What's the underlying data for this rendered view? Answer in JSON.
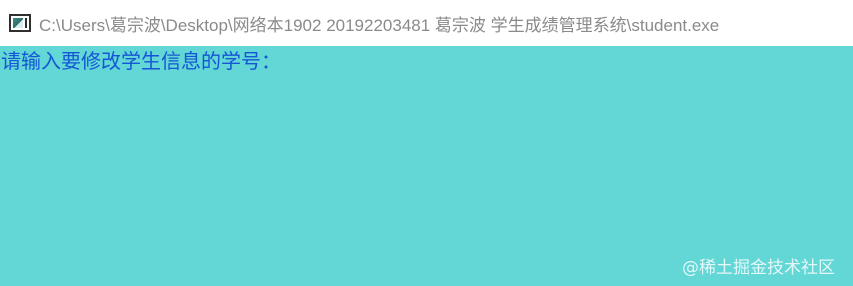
{
  "window": {
    "title": "C:\\Users\\葛宗波\\Desktop\\网络本1902 20192203481 葛宗波 学生成绩管理系统\\student.exe",
    "icon": "console-app-icon"
  },
  "console": {
    "background_color": "#63d6d6",
    "text_color": "#1456d6",
    "prompt": "请输入要修改学生信息的学号："
  },
  "watermark": {
    "text": "@稀土掘金技术社区"
  }
}
